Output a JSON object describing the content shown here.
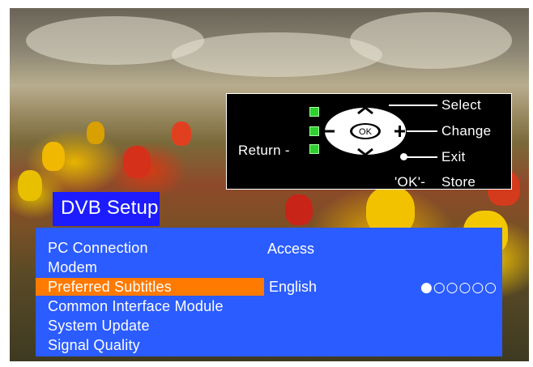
{
  "help": {
    "select": "Select",
    "change": "Change",
    "exit": "Exit",
    "return": "Return -",
    "ok_store_prefix": "'OK'-",
    "store": "Store",
    "ok": "OK"
  },
  "title": "DVB Setup",
  "menu": {
    "items": [
      {
        "label": "PC Connection",
        "value": "Access"
      },
      {
        "label": "Modem",
        "value": ""
      },
      {
        "label": "Preferred Subtitles",
        "value": "English",
        "selected": true
      },
      {
        "label": "Common Interface Module",
        "value": ""
      },
      {
        "label": "System Update",
        "value": ""
      },
      {
        "label": "Signal Quality",
        "value": ""
      }
    ],
    "selection_dots": "●○○○○○"
  },
  "colors": {
    "menu_bg": "#2b5cff",
    "title_bg": "#1c1cff",
    "highlight": "#ff7a00",
    "help_bg": "#000000",
    "key_green": "#2fd02f"
  },
  "icons": [
    "remote-dpad-icon",
    "green-key-icon",
    "up-arrow-icon",
    "down-arrow-icon",
    "minus-icon",
    "plus-icon"
  ]
}
